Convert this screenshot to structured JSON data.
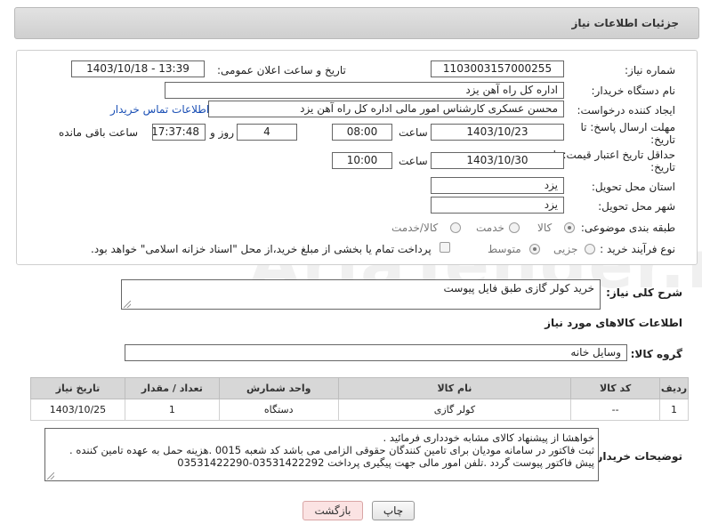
{
  "header": {
    "title": "جزئیات اطلاعات نیاز"
  },
  "form": {
    "need_number_label": "شماره نیاز:",
    "need_number": "1103003157000255",
    "announce_label": "تاریخ و ساعت اعلان عمومی:",
    "announce_value": "1403/10/18 - 13:39",
    "buyer_label": "نام دستگاه خریدار:",
    "buyer_value": "اداره کل راه آهن یزد",
    "creator_label": "ایجاد کننده درخواست:",
    "creator_value": "محسن عسکری کارشناس امور مالی اداره کل راه آهن یزد",
    "contact_link": "اطلاعات تماس خریدار",
    "deadline_label_1": "مهلت ارسال پاسخ: تا",
    "deadline_label_2": "تاریخ:",
    "deadline_date": "1403/10/23",
    "time_label": "ساعت",
    "deadline_time": "08:00",
    "days_value": "4",
    "days_label": "روز و",
    "remaining_time": "17:37:48",
    "remaining_label": "ساعت باقی مانده",
    "validity_label_1": "حداقل تاریخ اعتبار قیمت: تا",
    "validity_label_2": "تاریخ:",
    "validity_date": "1403/10/30",
    "validity_time": "10:00",
    "province_label": "استان محل تحویل:",
    "province_value": "یزد",
    "city_label": "شهر محل تحویل:",
    "city_value": "یزد",
    "category_label": "طبقه بندی موضوعی:",
    "category_options": [
      "کالا",
      "خدمت",
      "کالا/خدمت"
    ],
    "process_label": "نوع فرآیند خرید :",
    "process_options": [
      "جزیی",
      "متوسط"
    ],
    "payment_note": "پرداخت تمام یا بخشی از مبلغ خرید،از محل \"اسناد خزانه اسلامی\" خواهد بود."
  },
  "description": {
    "label": "شرح کلی نیاز:",
    "value": "خرید کولر گازی طبق فایل پیوست"
  },
  "goods": {
    "section_title": "اطلاعات کالاهای مورد نیاز",
    "group_label": "گروه کالا:",
    "group_value": "وسایل خانه",
    "columns": [
      "ردیف",
      "کد کالا",
      "نام کالا",
      "واحد شمارش",
      "تعداد / مقدار",
      "تاریخ نیاز"
    ],
    "rows": [
      [
        "1",
        "--",
        "کولر گازی",
        "دستگاه",
        "1",
        "1403/10/25"
      ]
    ]
  },
  "buyer_notes": {
    "label": "توضیحات خریدار:",
    "line1": "خواهشا  از پیشنهاد کالای مشابه خودداری فرمائید .",
    "line2": "ثبت فاکتور در سامانه مودیان برای تامین کنندگان حقوقی الزامی می باشد کد شعبه 0015 .هزینه حمل به عهده تامین کننده .",
    "line3": "پیش فاکتور پیوست گردد .تلفن امور مالی جهت پیگیری پرداخت 03531422292-03531422290"
  },
  "buttons": {
    "print": "چاپ",
    "back": "بازگشت"
  },
  "watermark": "AriaTender.net"
}
